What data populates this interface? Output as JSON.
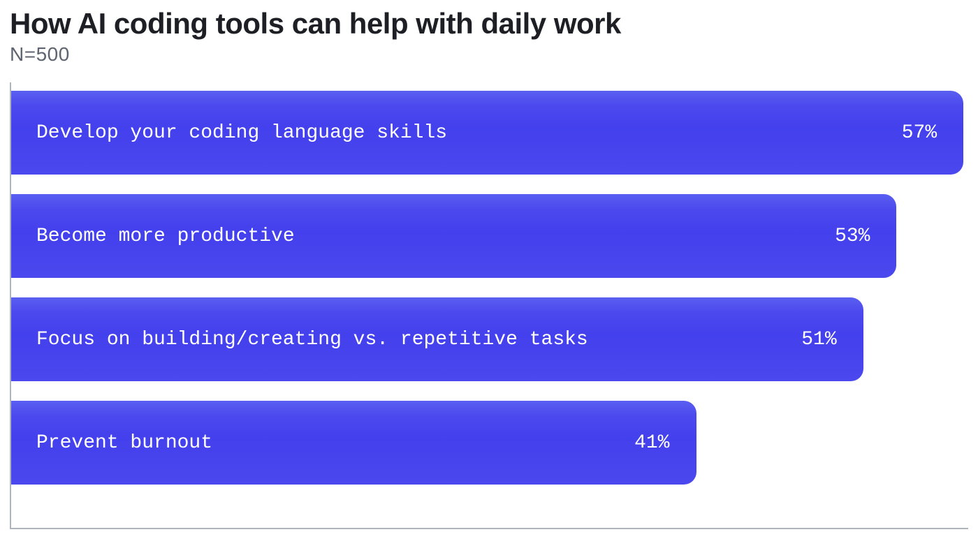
{
  "title": "How AI coding tools can help with daily work",
  "subtitle": "N=500",
  "chart_data": {
    "type": "bar",
    "orientation": "horizontal",
    "title": "How AI coding tools can help with daily work",
    "n": 500,
    "xlim": [
      0,
      57
    ],
    "unit": "%",
    "bar_color": "#4844ee",
    "categories": [
      "Develop your coding language skills",
      "Become more productive",
      "Focus on building/creating vs. repetitive tasks",
      "Prevent burnout"
    ],
    "values": [
      57,
      53,
      51,
      41
    ],
    "value_labels": [
      "57%",
      "53%",
      "51%",
      "41%"
    ]
  }
}
